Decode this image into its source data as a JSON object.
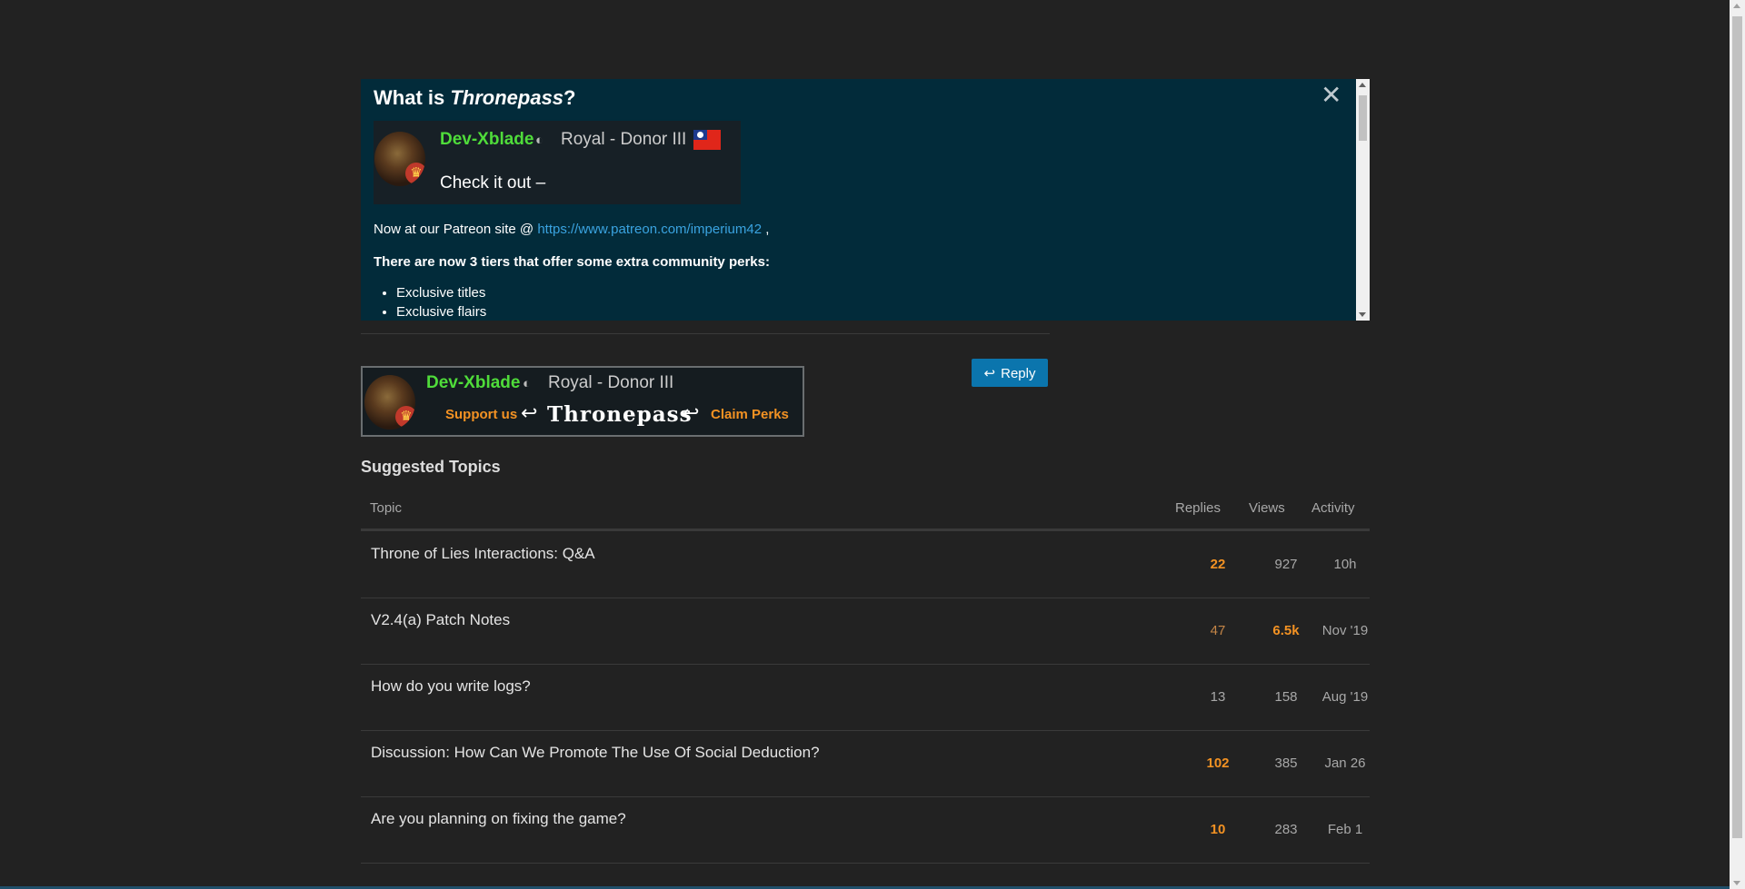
{
  "banner": {
    "title_pre": "What is ",
    "title_em": "Thronepass",
    "title_post": "?",
    "close": "✕",
    "signature": {
      "name": "Dev-Xblade",
      "title": "Royal - Donor III",
      "message": "Check it out –"
    },
    "patreon_pre": "Now at our Patreon site @ ",
    "patreon_link": "https://www.patreon.com/imperium42",
    "patreon_post": " ,",
    "tiers_text": "There are now 3 tiers that offer some extra community perks:",
    "perks": [
      "Exclusive titles",
      "Exclusive flairs"
    ]
  },
  "post_signature": {
    "name": "Dev-Xblade",
    "title": "Royal - Donor III",
    "support": "Support us",
    "arrows": "↩",
    "thronepass": "Thronepass",
    "claim": "Claim Perks"
  },
  "reply_button": {
    "icon": "↩",
    "label": "Reply"
  },
  "suggested": {
    "heading": "Suggested Topics",
    "columns": {
      "topic": "Topic",
      "replies": "Replies",
      "views": "Views",
      "activity": "Activity"
    },
    "topics": [
      {
        "title": "Throne of Lies Interactions: Q&A",
        "replies": "22",
        "views": "927",
        "activity": "10h"
      },
      {
        "title": "V2.4(a) Patch Notes",
        "replies": "47",
        "views": "6.5k",
        "activity": "Nov '19"
      },
      {
        "title": "How do you write logs?",
        "replies": "13",
        "views": "158",
        "activity": "Aug '19"
      },
      {
        "title": "Discussion: How Can We Promote The Use Of Social Deduction?",
        "replies": "102",
        "views": "385",
        "activity": "Jan 26"
      },
      {
        "title": "Are you planning on fixing the game?",
        "replies": "10",
        "views": "283",
        "activity": "Feb 1"
      }
    ]
  },
  "colors": {
    "accent_orange": "#f39223",
    "link_blue": "#3aa3e0",
    "name_green": "#4fdc3a",
    "banner_bg": "#022b3a",
    "reply_blue": "#0b75ad"
  }
}
